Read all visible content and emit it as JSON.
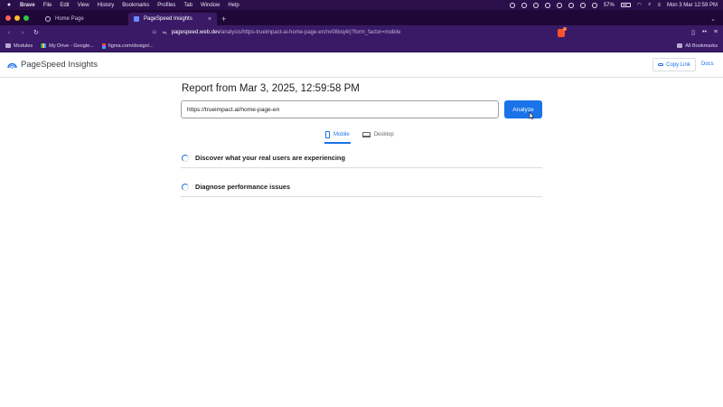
{
  "menubar": {
    "app": "Brave",
    "items": [
      "File",
      "Edit",
      "View",
      "History",
      "Bookmarks",
      "Profiles",
      "Tab",
      "Window",
      "Help"
    ],
    "battery": "57%",
    "clock": "Mon 3 Mar 12:59 PM"
  },
  "tabs": [
    {
      "title": "Home Page",
      "active": false
    },
    {
      "title": "PageSpeed Insights",
      "active": true
    }
  ],
  "toolbar": {
    "url_host": "pagespeed.web.dev",
    "url_path": "/analysis/https-trueimpact-ai-home-page-en/nv08ioq4rj?form_factor=mobile"
  },
  "bookmarks": {
    "items": [
      "Modules",
      "My Drive - Google...",
      "figma.com/design/..."
    ],
    "all": "All Bookmarks"
  },
  "psi": {
    "brand": "PageSpeed Insights",
    "copy_link": "Copy Link",
    "docs": "Docs",
    "report_title": "Report from Mar 3, 2025, 12:59:58 PM",
    "url_value": "https://trueimpact.ai/home-page-en",
    "analyze": "Analyze",
    "device_tabs": [
      "Mobile",
      "Desktop"
    ],
    "sections": [
      "Discover what your real users are experiencing",
      "Diagnose performance issues"
    ]
  },
  "colors": {
    "accent": "#1a73e8",
    "browser_chrome": "#3a1a66"
  }
}
